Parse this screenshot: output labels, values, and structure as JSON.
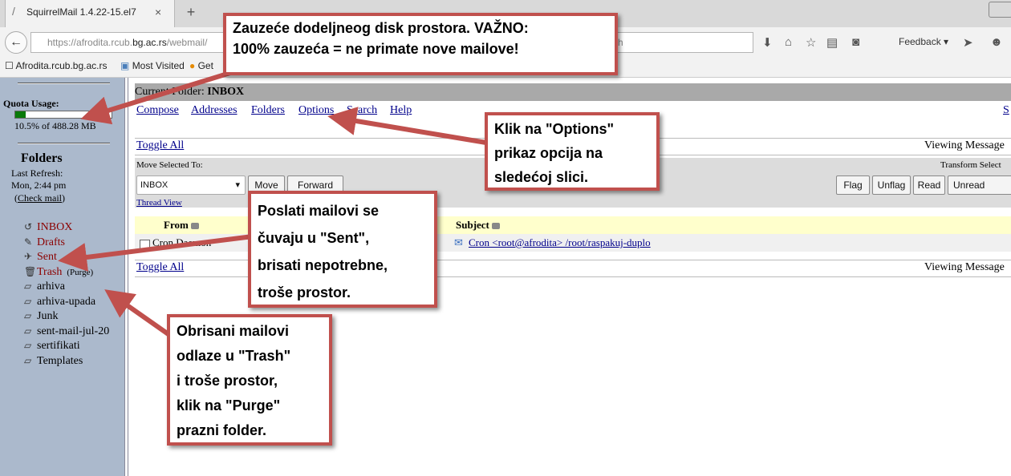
{
  "browser": {
    "tab_title": "SquirrelMail 1.4.22-15.el7",
    "url_prefix": "https://afrodita.rcub.",
    "url_host": "bg.ac.rs",
    "url_rest": "/webmail/",
    "search_tail": "h",
    "feedback_label": "Feedback",
    "bookmarks": [
      {
        "label": "Afrodita.rcub.bg.ac.rs"
      },
      {
        "label": "Most Visited"
      },
      {
        "label": "Get"
      }
    ]
  },
  "left": {
    "quota_label": "Quota Usage:",
    "quota_text": "10.5% of 488.28 MB",
    "quota_percent": 10.5,
    "folders_title": "Folders",
    "last_refresh_label": "Last Refresh:",
    "last_refresh_time": "Mon, 2:44 pm",
    "check_mail": "Check mail",
    "folders": [
      {
        "name": "INBOX",
        "special": true
      },
      {
        "name": "Drafts",
        "special": true
      },
      {
        "name": "Sent",
        "special": true
      },
      {
        "name": "Trash",
        "special": true,
        "extra": "(Purge)"
      },
      {
        "name": "arhiva",
        "special": false
      },
      {
        "name": "arhiva-upada",
        "special": false
      },
      {
        "name": "Junk",
        "special": false
      },
      {
        "name": "sent-mail-jul-20",
        "special": false
      },
      {
        "name": "sertifikati",
        "special": false
      },
      {
        "name": "Templates",
        "special": false
      }
    ]
  },
  "main": {
    "current_folder_label": "Current Folder:",
    "current_folder": "INBOX",
    "menu": [
      "Compose",
      "Addresses",
      "Folders",
      "Options",
      "Search",
      "Help"
    ],
    "menu_right": "S",
    "toggle_all": "Toggle All",
    "viewing": "Viewing Message",
    "move_selected_to": "Move Selected To:",
    "transform_selected": "Transform Select",
    "move_select_value": "INBOX",
    "move_button": "Move",
    "forward_button": "Forward",
    "thread_view": "Thread View",
    "flag_buttons": [
      "Flag",
      "Unflag",
      "Read",
      "Unread"
    ],
    "col_from": "From",
    "col_subject": "Subject",
    "message": {
      "from": "Cron Daemon",
      "date_tail": "n",
      "subject": "Cron <root@afrodita> /root/raspakuj-duplo"
    }
  },
  "callouts": {
    "quota": [
      "Zauzeće dodeljneog disk prostora. VAŽNO:",
      "100% zauzeća = ne primate nove mailove!"
    ],
    "options": [
      "Klik na \"Options\"",
      "prikaz opcija na",
      "sledećoj slici."
    ],
    "sent": [
      "Poslati mailovi se",
      "čuvaju u \"Sent\",",
      "brisati nepotrebne,",
      "troše prostor."
    ],
    "trash": [
      "Obrisani mailovi",
      "odlaze u \"Trash\"",
      "i troše prostor,",
      "klik na \"Purge\"",
      "prazni folder."
    ]
  },
  "colors": {
    "annotation": "#c0504d",
    "quota_fill": "#0a7a0a",
    "left_pane": "#abb9cc"
  }
}
